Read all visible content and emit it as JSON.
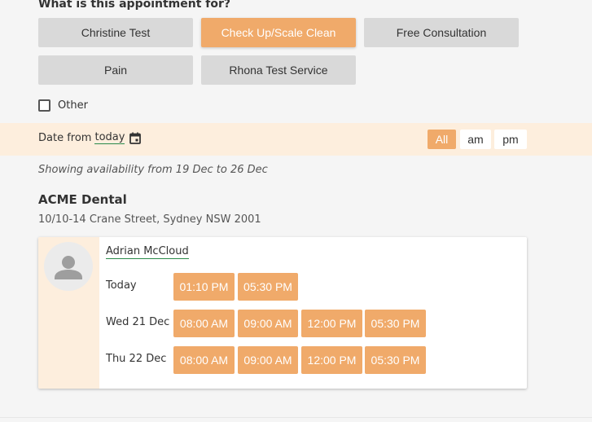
{
  "question": "What is this appointment for?",
  "services": [
    {
      "label": "Christine Test",
      "selected": false
    },
    {
      "label": "Check Up/Scale Clean",
      "selected": true
    },
    {
      "label": "Free Consultation",
      "selected": false
    },
    {
      "label": "Pain",
      "selected": false
    },
    {
      "label": "Rhona Test Service",
      "selected": false
    }
  ],
  "other": {
    "label": "Other",
    "checked": false
  },
  "date_filter": {
    "prefix": "Date from",
    "value": "today",
    "icon": "calendar-icon",
    "periods": [
      {
        "label": "All",
        "active": true
      },
      {
        "label": "am",
        "active": false
      },
      {
        "label": "pm",
        "active": false
      }
    ]
  },
  "availability_note": "Showing availability from 19 Dec to 26 Dec",
  "clinic": {
    "name": "ACME Dental",
    "address": "10/10-14 Crane Street, Sydney NSW 2001"
  },
  "practitioner": {
    "name": "Adrian McCloud",
    "avatar_icon": "person-icon",
    "days": [
      {
        "label": "Today",
        "slots": [
          "01:10 PM",
          "05:30 PM"
        ]
      },
      {
        "label": "Wed 21 Dec",
        "slots": [
          "08:00 AM",
          "09:00 AM",
          "12:00 PM",
          "05:30 PM"
        ]
      },
      {
        "label": "Thu 22 Dec",
        "slots": [
          "08:00 AM",
          "09:00 AM",
          "12:00 PM",
          "05:30 PM"
        ]
      }
    ]
  },
  "colors": {
    "accent": "#f0aa6a",
    "band": "#fdeedd",
    "button_grey": "#d9d9d9",
    "link_underline": "#2a8a4a"
  }
}
